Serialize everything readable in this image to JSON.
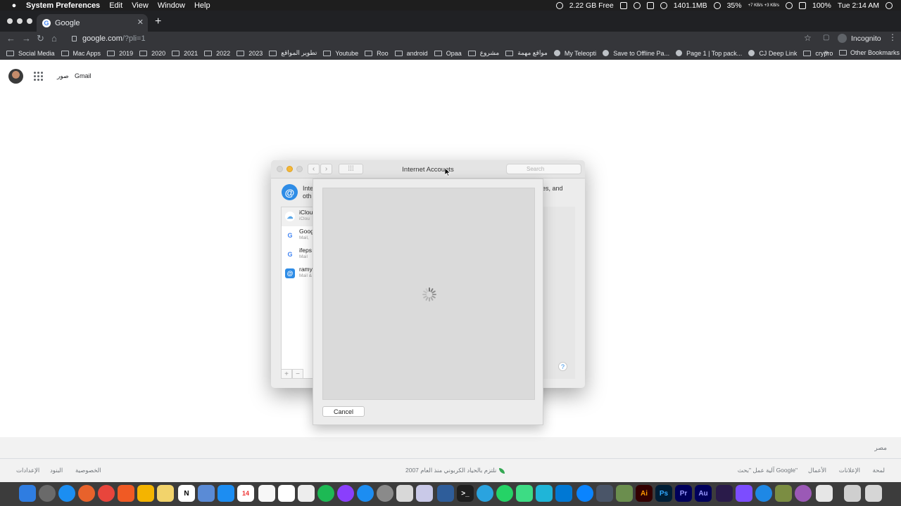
{
  "menubar": {
    "app_name": "System Preferences",
    "menus": [
      "Edit",
      "View",
      "Window",
      "Help"
    ],
    "status": {
      "disk_free": "2.22 GB Free",
      "memory": "1401.1MB",
      "battery_small": "35%",
      "net_up": "+7 KB/s",
      "net_down": "+3 KB/s",
      "battery": "100%",
      "clock": "Tue 2:14 AM"
    }
  },
  "browser": {
    "tab_title": "Google",
    "url_host": "google.com",
    "url_path": "/?pli=1",
    "profile_label": "Incognito",
    "bookmarks": [
      "Social Media",
      "Mac Apps",
      "2019",
      "2020",
      "2021",
      "2022",
      "2023",
      "تطوير المواقع",
      "Youtube",
      "Roo",
      "android",
      "Opaa",
      "مشروع",
      "مواقع مهمة",
      "My Teleopti",
      "Save to Offline Pa...",
      "Page 1 | Top pack...",
      "CJ Deep Link",
      "crypro"
    ],
    "other_bookmarks": "Other Bookmarks"
  },
  "google": {
    "header_links": {
      "images": "صور",
      "gmail": "Gmail"
    },
    "country": "مصر",
    "footer_right": [
      "لمحة",
      "الإعلانات",
      "الأعمال",
      "آلية عمل \"بحث Google\""
    ],
    "footer_center": "نلتزم بالحياد الكربوني منذ العام 2007",
    "footer_left": [
      "الخصوصية",
      "البنود",
      "الإعدادات"
    ]
  },
  "prefs_window": {
    "title": "Internet Accounts",
    "search_placeholder": "Search",
    "description_left": [
      "Inte",
      "oth"
    ],
    "description_right": "ges, and",
    "accounts": [
      {
        "name": "iClou",
        "sub": "iClou",
        "icon": "icloud-icon"
      },
      {
        "name": "Goog",
        "sub": "Mail, ",
        "icon": "google-icon"
      },
      {
        "name": "ifeps",
        "sub": "Mail",
        "icon": "google-icon"
      },
      {
        "name": "ramy",
        "sub": "Mail &",
        "icon": "at-icon"
      }
    ],
    "add_label": "+",
    "remove_label": "−",
    "help_label": "?"
  },
  "sheet": {
    "cancel_label": "Cancel",
    "loading": true
  },
  "colors": {
    "browser_dark": "#35363a",
    "accent_blue": "#2e8ce6",
    "google_footer": "#f2f2f2"
  }
}
